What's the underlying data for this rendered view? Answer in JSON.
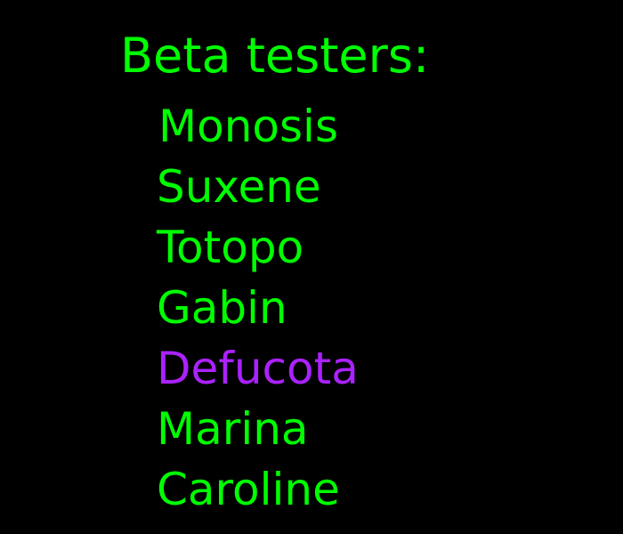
{
  "title": "Beta testers:",
  "colors": {
    "background": "#000000",
    "text": "#00ff00",
    "highlight": "#aa22ff"
  },
  "testers": [
    "Monosis",
    "Suxene",
    "Totopo",
    "Gabin",
    "Defucota",
    "Marina",
    "Caroline"
  ],
  "highlighted_tester": "Defucota"
}
